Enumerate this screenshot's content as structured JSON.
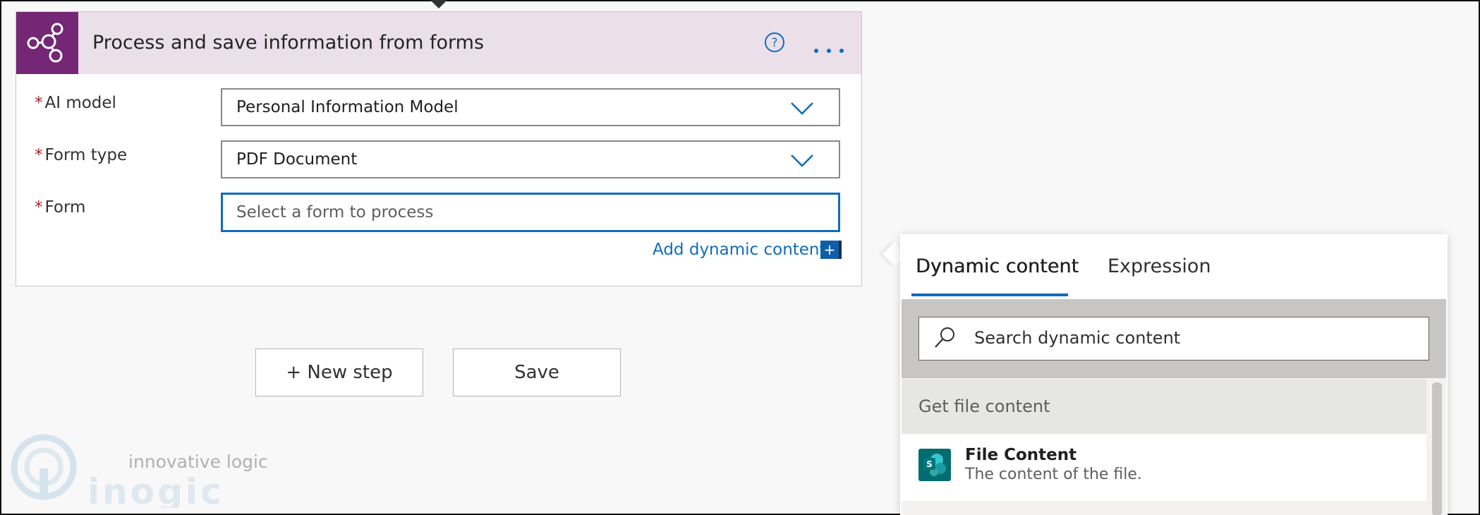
{
  "card": {
    "title": "Process and save information from forms",
    "icons": {
      "action": "ai-builder-icon",
      "help": "help-icon",
      "more": "more-options-icon"
    }
  },
  "fields": {
    "required_marker": "*",
    "ai_model": {
      "label": "AI model",
      "value": "Personal Information Model"
    },
    "form_type": {
      "label": "Form type",
      "value": "PDF Document"
    },
    "form": {
      "label": "Form",
      "placeholder": "Select a form to process"
    }
  },
  "add_dynamic": {
    "label": "Add dynamic content",
    "button": "+"
  },
  "buttons": {
    "new_step": "+ New step",
    "save": "Save"
  },
  "watermark": {
    "tagline": "innovative logic",
    "brand": "inogic"
  },
  "dynamic_panel": {
    "tabs": [
      "Dynamic content",
      "Expression"
    ],
    "active_tab": "Dynamic content",
    "search_placeholder": "Search dynamic content",
    "group": "Get file content",
    "items": [
      {
        "title": "File Content",
        "description": "The content of the file.",
        "icon": "sharepoint-icon"
      }
    ]
  },
  "colors": {
    "accent": "#0f6cbd",
    "card_header": "#ebe0ea",
    "ai_builder_purple": "#742774",
    "required": "#a4262c",
    "sharepoint_teal": "#036c70"
  }
}
